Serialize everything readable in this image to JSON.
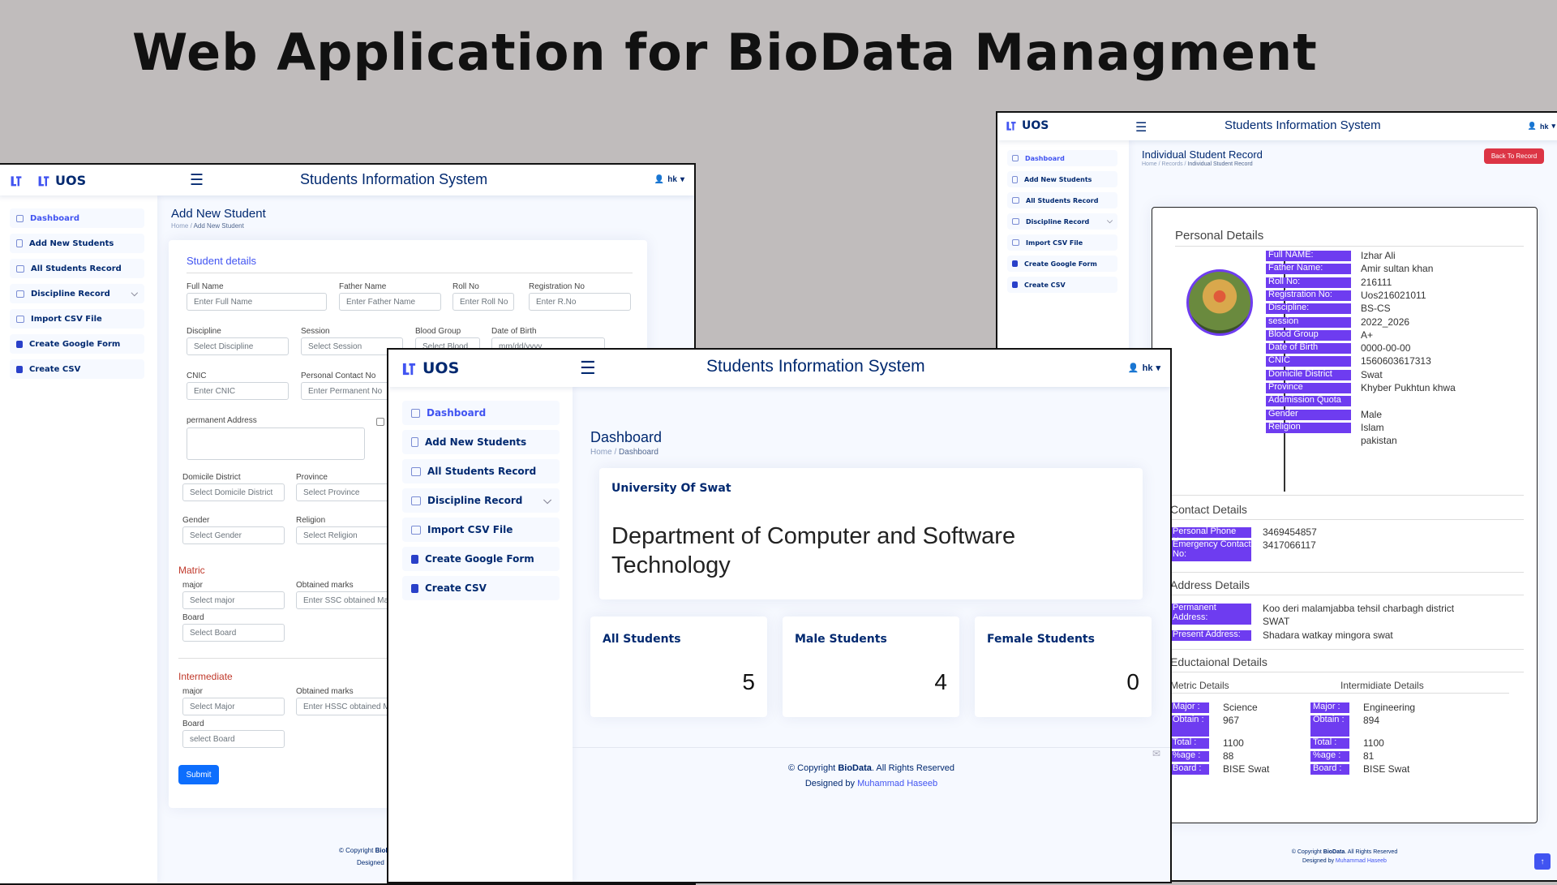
{
  "banner_title": "Web Application for BioData Managment",
  "app": {
    "logo_text": "UOS",
    "title": "Students Information System",
    "user": "hk",
    "nav": [
      "Dashboard",
      "Add New Students",
      "All Students Record",
      "Discipline Record",
      "Import CSV File",
      "Create Google Form",
      "Create CSV"
    ]
  },
  "add_student": {
    "page_title": "Add New Student",
    "breadcrumb": [
      "Home",
      "Add New Student"
    ],
    "card_title": "Student details",
    "fields": {
      "full_name": {
        "label": "Full Name",
        "placeholder": "Enter Full Name"
      },
      "father_name": {
        "label": "Father Name",
        "placeholder": "Enter Father Name"
      },
      "roll_no": {
        "label": "Roll No",
        "placeholder": "Enter Roll No"
      },
      "reg_no": {
        "label": "Registration No",
        "placeholder": "Enter R.No"
      },
      "discipline": {
        "label": "Discipline",
        "placeholder": "Select Discipline"
      },
      "session": {
        "label": "Session",
        "placeholder": "Select Session"
      },
      "blood_group": {
        "label": "Blood Group",
        "placeholder": "Select Blood"
      },
      "dob": {
        "label": "Date of Birth",
        "placeholder": "mm/dd/yyyy"
      },
      "cnic": {
        "label": "CNIC",
        "placeholder": "Enter CNIC"
      },
      "contact": {
        "label": "Personal Contact No",
        "placeholder": "Enter Permanent No"
      },
      "address": {
        "label": "permanent Address"
      },
      "domicile": {
        "label": "Domicile District",
        "placeholder": "Select Domicile District"
      },
      "province": {
        "label": "Province",
        "placeholder": "Select Province"
      },
      "gender": {
        "label": "Gender",
        "placeholder": "Select Gender"
      },
      "religion": {
        "label": "Religion",
        "placeholder": "Select Religion"
      }
    },
    "matric": {
      "title": "Matric",
      "major_label": "major",
      "major_placeholder": "Select major",
      "marks_label": "Obtained marks",
      "marks_placeholder": "Enter SSC obtained Marks",
      "board_label": "Board",
      "board_placeholder": "Select Board"
    },
    "intermediate": {
      "title": "Intermediate",
      "major_label": "major",
      "major_placeholder": "Select Major",
      "marks_label": "Obtained marks",
      "marks_placeholder": "Enter HSSC obtained Marks",
      "board_label": "Board",
      "board_placeholder": "select Board"
    },
    "submit": "Submit",
    "footer_copy": "© Copyright",
    "footer_brand": "BioData",
    "footer_designed": "Designed"
  },
  "dashboard": {
    "page_title": "Dashboard",
    "breadcrumb": [
      "Home",
      "Dashboard"
    ],
    "university": "University Of Swat",
    "department": "Department of Computer and Software Technology",
    "stats": [
      {
        "label": "All Students",
        "value": "5"
      },
      {
        "label": "Male Students",
        "value": "4"
      },
      {
        "label": "Female Students",
        "value": "0"
      }
    ],
    "footer": {
      "copy": "© Copyright",
      "brand": "BioData",
      "rights": ". All Rights Reserved",
      "designed": "Designed by",
      "author": "Muhammad Haseeb"
    }
  },
  "record": {
    "page_title": "Individual Student Record",
    "breadcrumb": [
      "Home",
      "Records",
      "Individual Student Record"
    ],
    "back_button": "Back To Record",
    "personal_title": "Personal Details",
    "personal": [
      {
        "k": "Full NAME:",
        "v": "Izhar Ali"
      },
      {
        "k": "Father Name:",
        "v": "Amir sultan khan"
      },
      {
        "k": "Roll No:",
        "v": "216111"
      },
      {
        "k": "Registration No:",
        "v": "Uos216021011"
      },
      {
        "k": "Discipline:",
        "v": "BS-CS"
      },
      {
        "k": "session",
        "v": "2022_2026"
      },
      {
        "k": "Blood Group",
        "v": "A+"
      },
      {
        "k": "Date of Birth",
        "v": "0000-00-00"
      },
      {
        "k": "CNIC",
        "v": "1560603617313"
      },
      {
        "k": "Domicile District",
        "v": "Swat"
      },
      {
        "k": "Province",
        "v": "Khyber Pukhtun khwa"
      },
      {
        "k": "Addmission Quota",
        "v": ""
      },
      {
        "k": "Gender",
        "v": "Male"
      },
      {
        "k": "Religion",
        "v": "Islam"
      },
      {
        "k": "",
        "v": "pakistan"
      }
    ],
    "contact_title": "Contact Details",
    "contact": [
      {
        "k": "Personal Phone No:",
        "v": "3469454857"
      },
      {
        "k": "Emergency Contact No:",
        "v": "3417066117"
      }
    ],
    "address_title": "Address Details",
    "address": [
      {
        "k": "Permanent Address:",
        "v": "Koo deri malamjabba tehsil charbagh district SWAT"
      },
      {
        "k": "Present Address:",
        "v": "Shadara watkay mingora swat"
      }
    ],
    "edu_title": "Eductaional Details",
    "metric_title": "Metric Details",
    "inter_title": "Intermidiate Details",
    "metric": [
      {
        "k": "Major :",
        "v": "Science"
      },
      {
        "k": "Obtain :",
        "v": "967"
      },
      {
        "k": "Total :",
        "v": "1100"
      },
      {
        "k": "%age :",
        "v": "88"
      },
      {
        "k": "Board :",
        "v": "BISE Swat"
      }
    ],
    "inter": [
      {
        "k": "Major :",
        "v": "Engineering"
      },
      {
        "k": "Obtain :",
        "v": "894"
      },
      {
        "k": "Total :",
        "v": "1100"
      },
      {
        "k": "%age :",
        "v": "81"
      },
      {
        "k": "Board :",
        "v": "BISE Swat"
      }
    ],
    "footer": {
      "copy": "© Copyright",
      "brand": "BioData",
      "rights": ". All Rights Reserved",
      "designed": "Designed by",
      "author": "Muhammad Haseeb"
    }
  },
  "colors": {
    "brand": "#012970",
    "accent": "#4154f1",
    "chip": "#6e3cf0",
    "section": "#c0392b",
    "danger": "#dc3545",
    "primary": "#0d6efd"
  }
}
